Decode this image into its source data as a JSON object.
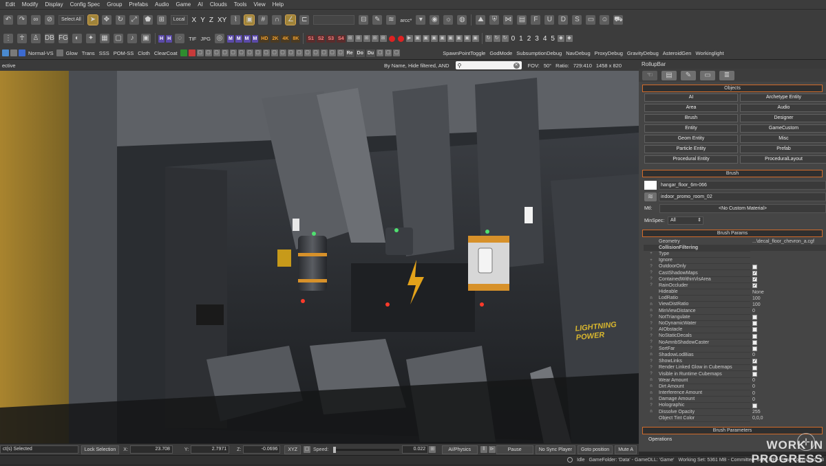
{
  "menubar": [
    "Edit",
    "Modify",
    "Display",
    "Config Spec",
    "Group",
    "Prefabs",
    "Audio",
    "Game",
    "AI",
    "Clouds",
    "Tools",
    "View",
    "Help"
  ],
  "toolbar1": {
    "select_mode": "Select All",
    "coord_space": "Local",
    "axis_x": "X",
    "axis_y": "Y",
    "axis_z": "Z",
    "axis_xy": "XY",
    "layer_name": "arcc*"
  },
  "toolbar2": {
    "tags_purple": [
      "H",
      "H"
    ],
    "img_formats": [
      "TIF",
      "JPG"
    ],
    "tags_m": [
      "M",
      "M",
      "M",
      "M"
    ],
    "res_tags": [
      "HD",
      "2K",
      "4K",
      "8K"
    ],
    "spec_tags": [
      "S1",
      "S2",
      "S3",
      "S4"
    ],
    "numbers": [
      "0",
      "1",
      "2",
      "3",
      "4",
      "5"
    ]
  },
  "toolbar3": {
    "left_items": [
      "Normal-VS",
      "Glow",
      "Trans",
      "SSS",
      "POM-SS",
      "Cloth",
      "ClearCoat"
    ],
    "right_items": [
      "SpawnPointToggle",
      "GodMode",
      "SubsumptionDebug",
      "NavDebug",
      "ProxyDebug",
      "GravityDebug",
      "AsteroidGen",
      "Workinglight"
    ],
    "re_tags": [
      "Re",
      "Do",
      "Du"
    ]
  },
  "viewport_bar": {
    "mode": "ective",
    "filter_text": "By Name, Hide filtered, AND",
    "fov_label": "FOV:",
    "fov_value": "50°",
    "ratio_label": "Ratio:",
    "ratio_value": "729:410",
    "resolution": "1458 x 820"
  },
  "viewport": {
    "sign_text": "LIGHTNING POWER"
  },
  "rollup": {
    "title": "RollupBar",
    "objects_header": "Objects",
    "object_buttons": [
      "AI",
      "Archetype Entity",
      "Area",
      "Audio",
      "Brush",
      "Designer",
      "Entity",
      "GameCustom",
      "Geom Entity",
      "Misc",
      "Particle Entity",
      "Prefab",
      "Procedural Entity",
      "ProceduralLayout"
    ],
    "brush_header": "Brush",
    "brush_name": "hangar_floor_6m-066",
    "brush_layer": "indoor_promo_room_02",
    "mtl_label": "Mtl:",
    "mtl_value": "<No Custom Material>",
    "minspec_label": "MinSpec:",
    "minspec_value": "All",
    "params_header": "Brush Params",
    "params": [
      {
        "m": "",
        "name": "Geometry",
        "value": "...\\decal_floor_chevron_a.cgf"
      },
      {
        "m": "",
        "name": "CollisionFiltering",
        "value": ""
      },
      {
        "m": "+",
        "name": "Type",
        "value": ""
      },
      {
        "m": "+",
        "name": "Ignore",
        "value": ""
      },
      {
        "m": "?",
        "name": "OutdoorOnly",
        "value": "",
        "chk": "off"
      },
      {
        "m": "?",
        "name": "CastShadowMaps",
        "value": "",
        "chk": "on"
      },
      {
        "m": "?",
        "name": "ContainedWithinVisArea",
        "value": "",
        "chk": "on"
      },
      {
        "m": "?",
        "name": "RainOccluder",
        "value": "",
        "chk": "on"
      },
      {
        "m": "",
        "name": "Hideable",
        "value": "None"
      },
      {
        "m": "n",
        "name": "LodRatio",
        "value": "100"
      },
      {
        "m": "n",
        "name": "ViewDistRatio",
        "value": "100"
      },
      {
        "m": "n",
        "name": "MinViewDistance",
        "value": "0"
      },
      {
        "m": "?",
        "name": "NotTriangulate",
        "value": "",
        "chk": "off"
      },
      {
        "m": "?",
        "name": "NoDynamicWater",
        "value": "",
        "chk": "off"
      },
      {
        "m": "?",
        "name": "AIObstacle",
        "value": "",
        "chk": "off"
      },
      {
        "m": "?",
        "name": "NoStaticDecals",
        "value": "",
        "chk": "off"
      },
      {
        "m": "?",
        "name": "NoAmnbShadowCaster",
        "value": "",
        "chk": "off"
      },
      {
        "m": "?",
        "name": "SortFar",
        "value": "",
        "chk": "off"
      },
      {
        "m": "n",
        "name": "ShadowLodBias",
        "value": "0"
      },
      {
        "m": "?",
        "name": "ShowLinks",
        "value": "",
        "chk": "on"
      },
      {
        "m": "?",
        "name": "Render Linked Glow in Cubemaps",
        "value": "",
        "chk": "off"
      },
      {
        "m": "?",
        "name": "Visible in Runtime Cubemaps",
        "value": "",
        "chk": "off"
      },
      {
        "m": "n",
        "name": "Wear Amount",
        "value": "0"
      },
      {
        "m": "n",
        "name": "Dirt Amount",
        "value": "0"
      },
      {
        "m": "n",
        "name": "Interference Amount",
        "value": "0"
      },
      {
        "m": "n",
        "name": "Damage Amount",
        "value": "0"
      },
      {
        "m": "?",
        "name": "Holographic",
        "value": "",
        "chk": "off"
      },
      {
        "m": "n",
        "name": "Dissolve Opacity",
        "value": "255"
      },
      {
        "m": "",
        "name": "Object Tint Color",
        "value": "0,0,0"
      }
    ],
    "parameters_header": "Brush Parameters",
    "operations_label": "Operations"
  },
  "statusbar": {
    "selected": "ct(s) Selected",
    "lock_selection": "Lock Selection",
    "x_label": "X:",
    "x_value": "23.708",
    "y_label": "Y:",
    "y_value": "2.7971",
    "z_label": "Z:",
    "z_value": "-0.0696",
    "axis": "XYZ",
    "speed_label": "Speed:",
    "speed_value": "0.022",
    "ai_physics": "AI/Physics",
    "pause": "Pause",
    "no_sync_player": "No Sync Player",
    "goto_position": "Goto position",
    "mute": "Mute A"
  },
  "bottombar": {
    "idle": "Idle",
    "game_folder": "GameFolder: 'Data' - GameDLL: 'Game'",
    "working_set": "Working Set: 5361 MB - Committed: 8488 MB - Peak Committed: 13",
    "watermark": "WORK IN PROGRESS"
  },
  "colors": {
    "accent": "#d36b2a",
    "panel": "#454545",
    "toolbar": "#3c3c3c"
  }
}
